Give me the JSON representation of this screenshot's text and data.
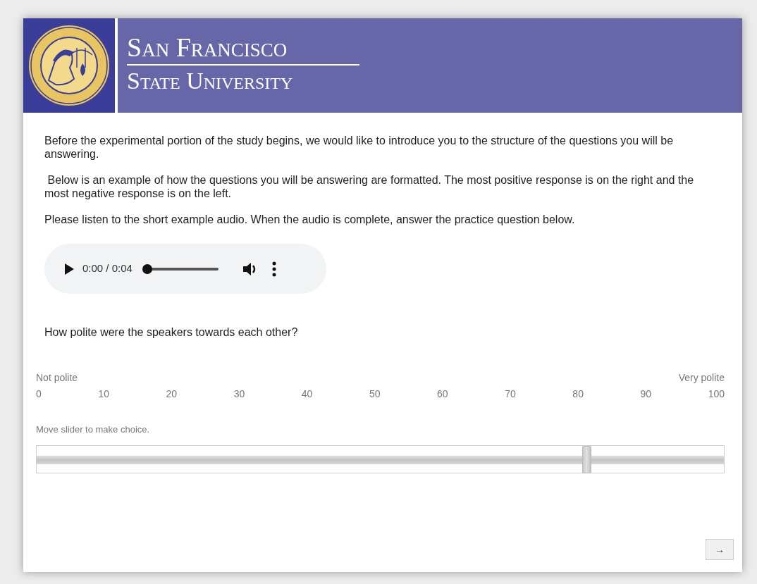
{
  "header": {
    "title_line_1": "San Francisco",
    "title_line_2": "State University"
  },
  "paragraphs": [
    "Before the experimental portion of the study begins, we would like to introduce you to the structure of the questions you will be answering.",
    " Below is an example of how the questions you will be answering are formatted. The most positive response is on the right and the most negative response is on the left.",
    "Please listen to the short example audio. When the audio is complete, answer the practice question below."
  ],
  "audio_player": {
    "time": "0:00 / 0:04",
    "level": 0
  },
  "question": {
    "text": "How polite were the speakers towards each other?",
    "left_label": "Not polite",
    "right_label": "Very polite",
    "ticks": [
      "0",
      "10",
      "20",
      "30",
      "40",
      "50",
      "60",
      "70",
      "80",
      "90",
      "100"
    ],
    "instruction": "Move slider to make choice.",
    "level": 0.8
  },
  "next_button": {
    "label": "→"
  }
}
